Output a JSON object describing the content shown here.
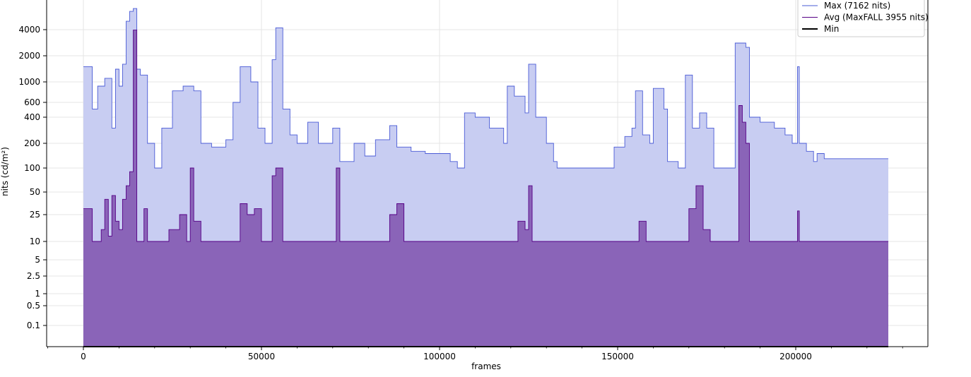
{
  "chart_data": {
    "type": "area",
    "xlabel": "frames",
    "ylabel": "nits (cd/m²)",
    "y_scale": "pq-log",
    "x_range": [
      -10000,
      230000
    ],
    "x_ticks": [
      0,
      50000,
      100000,
      150000,
      200000
    ],
    "x_tick_labels": [
      "0",
      "50000",
      "100000",
      "150000",
      "200000"
    ],
    "y_ticks": [
      0.1,
      0.5,
      1,
      2.5,
      5,
      10,
      25,
      50,
      100,
      200,
      400,
      600,
      1000,
      2000,
      4000
    ],
    "y_tick_labels": [
      "0.1",
      "0.5",
      "1",
      "2.5",
      "5",
      "10",
      "25",
      "50",
      "100",
      "200",
      "400",
      "600",
      "1000",
      "2000",
      "4000"
    ],
    "grid": true,
    "legend_position": "top-right",
    "series": [
      {
        "name": "Max (7162 nits)",
        "color": "#4a5bd6",
        "fill": "#c8cdf2",
        "points": [
          [
            0,
            1500
          ],
          [
            2000,
            1500
          ],
          [
            2500,
            500
          ],
          [
            4000,
            900
          ],
          [
            6000,
            1100
          ],
          [
            8000,
            300
          ],
          [
            9000,
            1400
          ],
          [
            10000,
            900
          ],
          [
            11000,
            1600
          ],
          [
            12000,
            5000
          ],
          [
            13000,
            6500
          ],
          [
            14000,
            7000
          ],
          [
            15000,
            1400
          ],
          [
            16000,
            1200
          ],
          [
            18000,
            200
          ],
          [
            20000,
            100
          ],
          [
            22000,
            300
          ],
          [
            25000,
            800
          ],
          [
            28000,
            900
          ],
          [
            31000,
            800
          ],
          [
            33000,
            200
          ],
          [
            36000,
            180
          ],
          [
            40000,
            220
          ],
          [
            42000,
            600
          ],
          [
            44000,
            1500
          ],
          [
            47000,
            1000
          ],
          [
            49000,
            300
          ],
          [
            51000,
            200
          ],
          [
            53000,
            1800
          ],
          [
            54000,
            4200
          ],
          [
            56000,
            500
          ],
          [
            58000,
            250
          ],
          [
            60000,
            200
          ],
          [
            63000,
            350
          ],
          [
            66000,
            200
          ],
          [
            70000,
            300
          ],
          [
            72000,
            120
          ],
          [
            76000,
            200
          ],
          [
            79000,
            140
          ],
          [
            82000,
            220
          ],
          [
            86000,
            320
          ],
          [
            88000,
            180
          ],
          [
            92000,
            160
          ],
          [
            96000,
            150
          ],
          [
            100000,
            150
          ],
          [
            103000,
            120
          ],
          [
            105000,
            100
          ],
          [
            107000,
            450
          ],
          [
            110000,
            400
          ],
          [
            114000,
            300
          ],
          [
            118000,
            200
          ],
          [
            119000,
            900
          ],
          [
            121000,
            700
          ],
          [
            124000,
            450
          ],
          [
            125000,
            1600
          ],
          [
            127000,
            400
          ],
          [
            130000,
            200
          ],
          [
            132000,
            120
          ],
          [
            133000,
            100
          ],
          [
            138000,
            100
          ],
          [
            142000,
            100
          ],
          [
            147000,
            100
          ],
          [
            149000,
            180
          ],
          [
            152000,
            240
          ],
          [
            154000,
            300
          ],
          [
            155000,
            800
          ],
          [
            157000,
            250
          ],
          [
            159000,
            200
          ],
          [
            160000,
            850
          ],
          [
            163000,
            500
          ],
          [
            164000,
            120
          ],
          [
            167000,
            100
          ],
          [
            169000,
            1200
          ],
          [
            171000,
            300
          ],
          [
            173000,
            450
          ],
          [
            175000,
            300
          ],
          [
            177000,
            100
          ],
          [
            181000,
            100
          ],
          [
            183000,
            2800
          ],
          [
            185000,
            2800
          ],
          [
            186000,
            2500
          ],
          [
            187000,
            400
          ],
          [
            190000,
            350
          ],
          [
            194000,
            300
          ],
          [
            197000,
            250
          ],
          [
            199000,
            200
          ],
          [
            200500,
            1500
          ],
          [
            201000,
            200
          ],
          [
            203000,
            160
          ],
          [
            205000,
            120
          ],
          [
            206000,
            150
          ],
          [
            208000,
            130
          ],
          [
            226000,
            130
          ]
        ]
      },
      {
        "name": "Avg (MaxFALL 3955 nits)",
        "color": "#560086",
        "fill": "#8a64b8",
        "points": [
          [
            0,
            30
          ],
          [
            2000,
            30
          ],
          [
            2500,
            10
          ],
          [
            5000,
            15
          ],
          [
            6000,
            40
          ],
          [
            7000,
            12
          ],
          [
            8000,
            45
          ],
          [
            9000,
            20
          ],
          [
            10000,
            15
          ],
          [
            11000,
            40
          ],
          [
            12000,
            60
          ],
          [
            13000,
            90
          ],
          [
            14000,
            3955
          ],
          [
            15000,
            10
          ],
          [
            17000,
            30
          ],
          [
            18000,
            10
          ],
          [
            22000,
            10
          ],
          [
            24000,
            15
          ],
          [
            27000,
            25
          ],
          [
            29000,
            10
          ],
          [
            30000,
            100
          ],
          [
            31000,
            20
          ],
          [
            33000,
            10
          ],
          [
            42000,
            10
          ],
          [
            44000,
            35
          ],
          [
            46000,
            25
          ],
          [
            48000,
            30
          ],
          [
            50000,
            10
          ],
          [
            53000,
            80
          ],
          [
            54000,
            100
          ],
          [
            56000,
            10
          ],
          [
            70000,
            10
          ],
          [
            71000,
            100
          ],
          [
            72000,
            10
          ],
          [
            84000,
            10
          ],
          [
            86000,
            25
          ],
          [
            88000,
            35
          ],
          [
            90000,
            10
          ],
          [
            120000,
            10
          ],
          [
            122000,
            20
          ],
          [
            124000,
            15
          ],
          [
            125000,
            60
          ],
          [
            126000,
            10
          ],
          [
            155000,
            10
          ],
          [
            156000,
            20
          ],
          [
            158000,
            10
          ],
          [
            168000,
            10
          ],
          [
            170000,
            30
          ],
          [
            172000,
            60
          ],
          [
            174000,
            15
          ],
          [
            176000,
            10
          ],
          [
            183000,
            10
          ],
          [
            184000,
            550
          ],
          [
            185000,
            350
          ],
          [
            186000,
            200
          ],
          [
            187000,
            10
          ],
          [
            200000,
            10
          ],
          [
            200500,
            28
          ],
          [
            201000,
            10
          ],
          [
            226000,
            10
          ]
        ]
      },
      {
        "name": "Min",
        "color": "#000000",
        "points": [
          [
            0,
            0.02
          ],
          [
            226000,
            0.02
          ]
        ]
      }
    ]
  }
}
